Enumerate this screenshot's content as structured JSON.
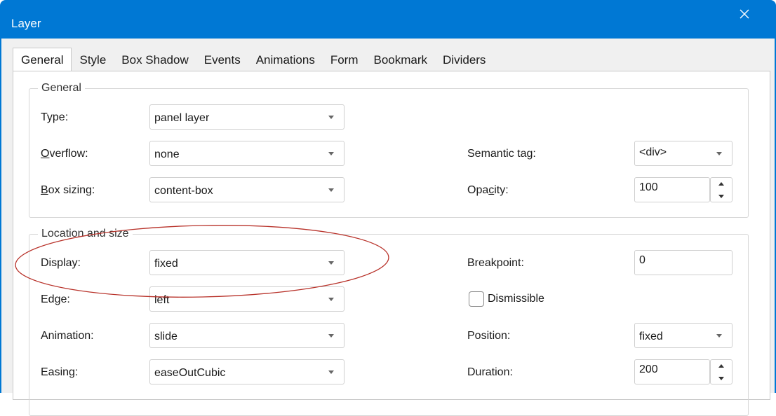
{
  "window": {
    "title": "Layer",
    "close_glyph": "✕"
  },
  "tabs": [
    "General",
    "Style",
    "Box Shadow",
    "Events",
    "Animations",
    "Form",
    "Bookmark",
    "Dividers"
  ],
  "active_tab": "General",
  "general_group": {
    "legend": "General",
    "type_label": "Type:",
    "type_value": "panel layer",
    "overflow_label_mnemonic": "O",
    "overflow_label_rest": "verflow:",
    "overflow_value": "none",
    "box_sizing_label_mnemonic": "B",
    "box_sizing_label_rest": "ox sizing:",
    "box_sizing_value": "content-box",
    "semantic_tag_label": "Semantic tag:",
    "semantic_tag_value": "<div>",
    "opacity_label_pre": "Opa",
    "opacity_label_mnemonic": "c",
    "opacity_label_post": "ity:",
    "opacity_value": "100"
  },
  "location_group": {
    "legend": "Location and size",
    "display_label": "Display:",
    "display_value": "fixed",
    "edge_label": "Edge:",
    "edge_value": "left",
    "animation_label": "Animation:",
    "animation_value": "slide",
    "easing_label": "Easing:",
    "easing_value": "easeOutCubic",
    "breakpoint_label": "Breakpoint:",
    "breakpoint_value": "0",
    "dismissible_label": "Dismissible",
    "dismissible_checked": false,
    "position_label": "Position:",
    "position_value": "fixed",
    "duration_label": "Duration:",
    "duration_value": "200"
  },
  "colors": {
    "titlebar": "#0078d4",
    "annotation_ellipse": "#b8322a"
  },
  "icons": {
    "close": "close-icon",
    "dropdown": "chevron-down-icon",
    "spin_up": "spin-up-icon",
    "spin_down": "spin-down-icon"
  }
}
